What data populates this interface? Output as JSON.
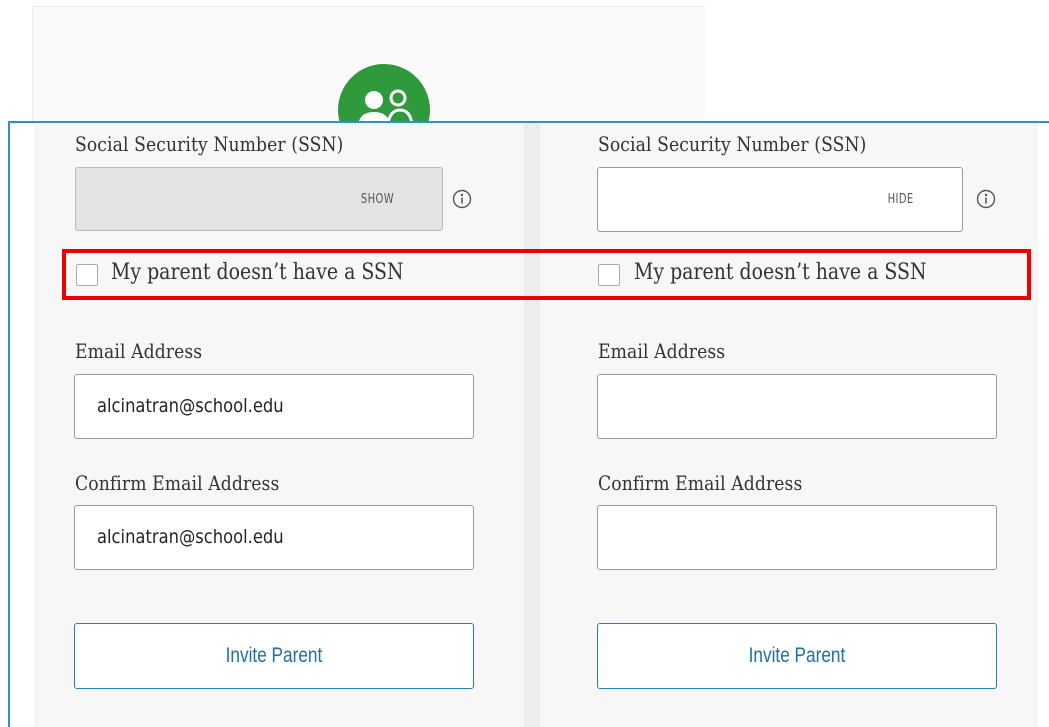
{
  "colors": {
    "accent_green": "#2e9a3b",
    "frame_blue": "#2a93c8",
    "highlight_red": "#ec0000",
    "button_blue": "#1f6fa3"
  },
  "header": {
    "icon": "parents-icon"
  },
  "left": {
    "ssn_label": "Social Security Number (SSN)",
    "ssn_toggle": "SHOW",
    "ssn_value": "",
    "no_ssn_label": "My parent doesn’t have a SSN",
    "email_label": "Email Address",
    "email_value": "alcinatran@school.edu",
    "confirm_label": "Confirm Email Address",
    "confirm_value": "alcinatran@school.edu",
    "button": "Invite Parent"
  },
  "right": {
    "ssn_label": "Social Security Number (SSN)",
    "ssn_toggle": "HIDE",
    "ssn_value": "",
    "no_ssn_label": "My parent doesn’t have a SSN",
    "email_label": "Email Address",
    "email_value": "",
    "confirm_label": "Confirm Email Address",
    "confirm_value": "",
    "button": "Invite Parent"
  }
}
